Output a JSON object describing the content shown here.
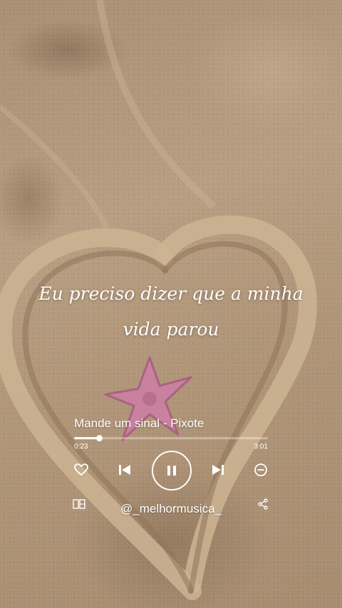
{
  "lyrics": {
    "line1": "Eu preciso dizer que a minha",
    "line2": "vida parou"
  },
  "player": {
    "track_title": "Mande um sinal - Pixote",
    "current_time": "0:23",
    "total_time": "3:01",
    "progress": 0.127,
    "buttons": {
      "like": "heart-icon",
      "previous": "skip-previous-icon",
      "pause": "pause-icon",
      "next": "skip-next-icon",
      "remove": "minus-circle-icon"
    }
  },
  "footer": {
    "handle": "@_melhormusica_",
    "left_icon": "gallery-icon",
    "right_icon": "share-icon"
  },
  "colors": {
    "text": "#ffffff",
    "sand": "#b79d80",
    "starfish": "#c8829f"
  }
}
